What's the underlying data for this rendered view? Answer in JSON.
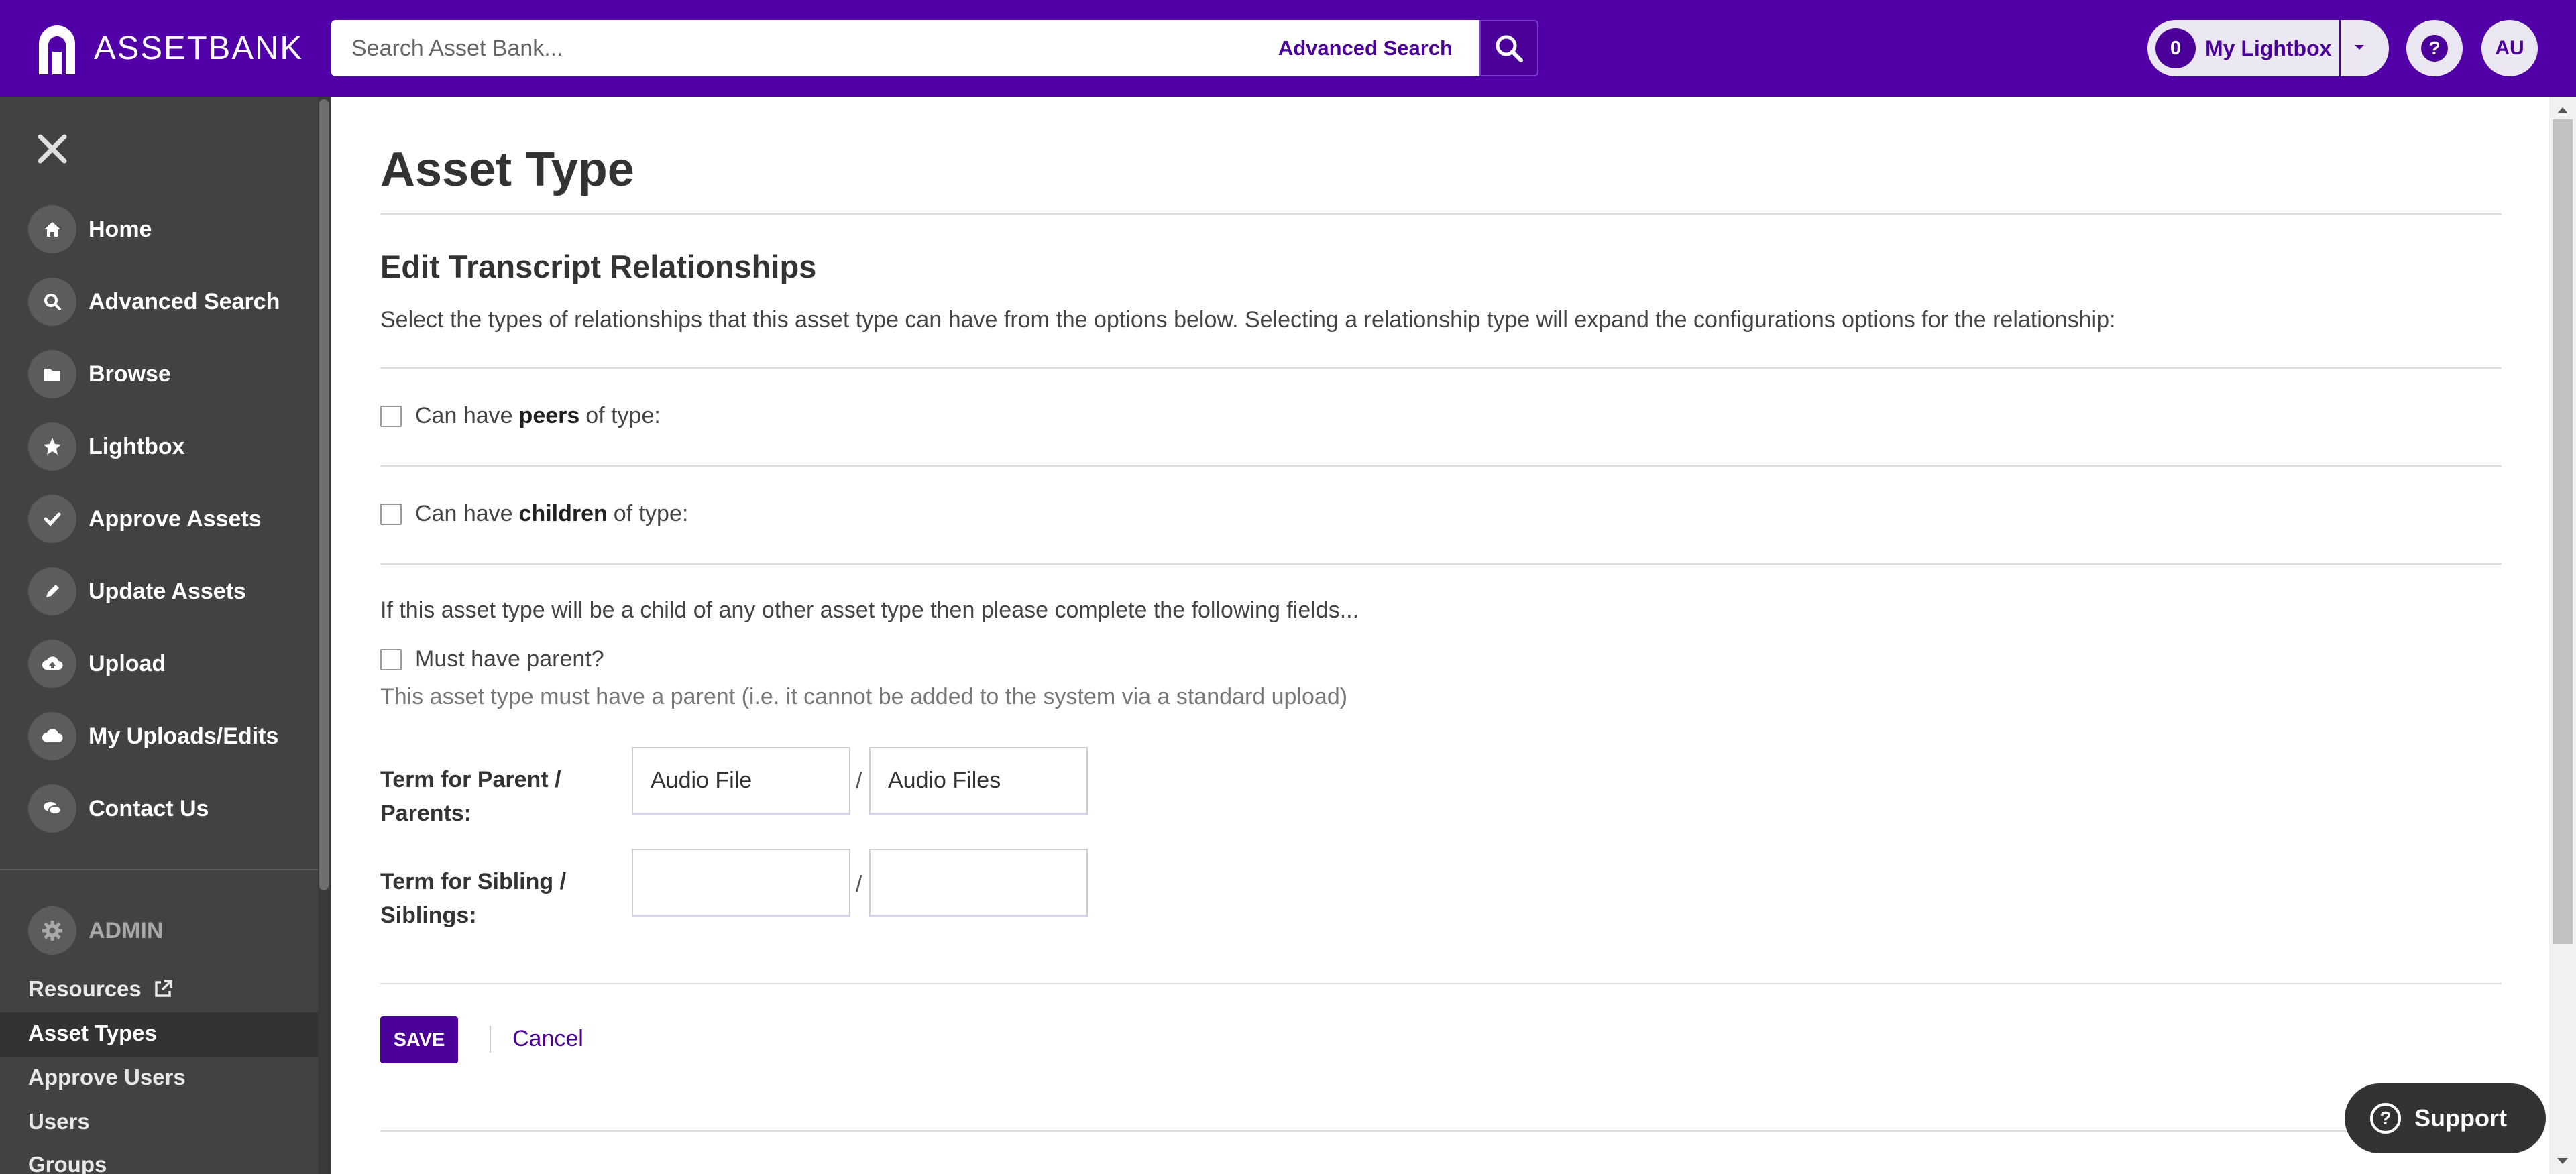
{
  "app": {
    "logo_text": "ASSETBANK"
  },
  "header": {
    "search_placeholder": "Search Asset Bank...",
    "advanced_search_label": "Advanced Search",
    "lightbox_count": "0",
    "lightbox_label": "My Lightbox",
    "avatar_initials": "AU"
  },
  "sidebar": {
    "items": [
      {
        "label": "Home",
        "icon": "home-icon"
      },
      {
        "label": "Advanced Search",
        "icon": "search-icon"
      },
      {
        "label": "Browse",
        "icon": "folder-icon"
      },
      {
        "label": "Lightbox",
        "icon": "star-icon"
      },
      {
        "label": "Approve Assets",
        "icon": "check-icon"
      },
      {
        "label": "Update Assets",
        "icon": "pencil-icon"
      },
      {
        "label": "Upload",
        "icon": "cloud-upload-icon"
      },
      {
        "label": "My Uploads/Edits",
        "icon": "cloud-icon"
      },
      {
        "label": "Contact Us",
        "icon": "chat-icon"
      }
    ],
    "admin_label": "ADMIN",
    "admin_links": [
      "Resources",
      "Asset Types",
      "Approve Users",
      "Users",
      "Groups"
    ],
    "active_admin_link": "Asset Types"
  },
  "main": {
    "page_title": "Asset Type",
    "section_title": "Edit Transcript Relationships",
    "intro": "Select the types of relationships that this asset type can have from the options below. Selecting a relationship type will expand the configurations options for the relationship:",
    "peers": {
      "before": "Can have",
      "bold": "peers",
      "after": "of type:"
    },
    "children": {
      "before": "Can have",
      "bold": "children",
      "after": "of type:"
    },
    "child_note": "If this asset type will be a child of any other asset type then please complete the following fields...",
    "must_have_parent_label": "Must have parent?",
    "must_have_parent_help": "This asset type must have a parent (i.e. it cannot be added to the system via a standard upload)",
    "parent_term_label": "Term for Parent / Parents:",
    "parent_singular": "Audio File",
    "parent_plural": "Audio Files",
    "sibling_term_label": "Term for Sibling / Siblings:",
    "sibling_singular": "",
    "sibling_plural": "",
    "slash": "/",
    "save_label": "SAVE",
    "cancel_label": "Cancel"
  },
  "support_label": "Support",
  "colors": {
    "brand": "#5000a6",
    "accent": "#4a0099",
    "sidebar": "#424242"
  }
}
